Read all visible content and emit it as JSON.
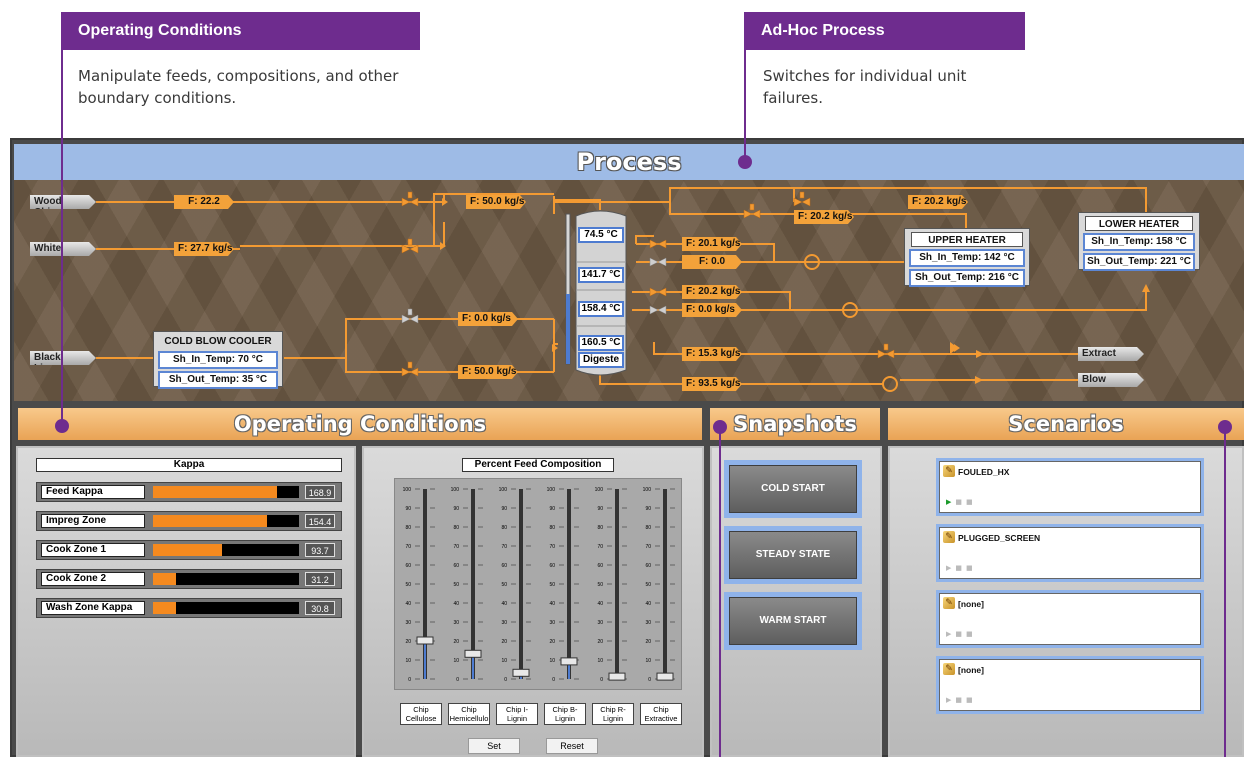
{
  "callouts": [
    {
      "title": "Operating Conditions",
      "text": "Manipulate feeds, compositions, and other boundary conditions."
    },
    {
      "title": "Ad-Hoc Process",
      "text": "Switches for individual unit failures."
    }
  ],
  "process": {
    "title": "Process",
    "streams": {
      "wood_chips": "Wood Chips",
      "white": "White",
      "black_liquor": "Black Liquor",
      "extract": "Extract",
      "blow": "Blow"
    },
    "flows": {
      "wood": "F: 22.2",
      "white": "F: 27.7 kg/s",
      "wood_to_digester": "F: 50.0 kg/s",
      "top_right": "F: 20.2 kg/s",
      "mid_top": "F: 20.2 kg/s",
      "upper_a": "F: 20.1 kg/s",
      "upper_b": "F: 0.0",
      "mid_a": "F: 20.2 kg/s",
      "mid_b": "F: 0.0 kg/s",
      "black_top": "F: 0.0 kg/s",
      "black_bot": "F: 50.0 kg/s",
      "extract": "F: 15.3 kg/s",
      "blow": "F: 93.5 kg/s"
    },
    "digester": {
      "t1": "74.5 °C",
      "t2": "141.7 °C",
      "t3": "158.4 °C",
      "t4": "160.5 °C",
      "label": "Digeste"
    },
    "cold_blow_cooler": {
      "title": "COLD BLOW COOLER",
      "in_temp": "Sh_In_Temp: 70 °C",
      "out_temp": "Sh_Out_Temp: 35 °C"
    },
    "upper_heater": {
      "title": "UPPER HEATER",
      "in_temp": "Sh_In_Temp: 142 °C",
      "out_temp": "Sh_Out_Temp: 216 °C"
    },
    "lower_heater": {
      "title": "LOWER HEATER",
      "in_temp": "Sh_In_Temp: 158 °C",
      "out_temp": "Sh_Out_Temp: 221 °C"
    }
  },
  "operating_conditions": {
    "title": "Operating Conditions",
    "kappa_title": "Kappa",
    "kappa": [
      {
        "label": "Feed Kappa",
        "value": "168.9",
        "fraction": 0.85
      },
      {
        "label": "Impreg Zone",
        "value": "154.4",
        "fraction": 0.78
      },
      {
        "label": "Cook Zone 1",
        "value": "93.7",
        "fraction": 0.47
      },
      {
        "label": "Cook Zone 2",
        "value": "31.2",
        "fraction": 0.16
      },
      {
        "label": "Wash Zone Kappa",
        "value": "30.8",
        "fraction": 0.16
      }
    ],
    "composition_title": "Percent Feed Composition",
    "scale_ticks": [
      "100",
      "90",
      "80",
      "70",
      "60",
      "50",
      "40",
      "30",
      "20",
      "10",
      "0"
    ],
    "components": [
      {
        "label": "Chip Cellulose",
        "value": 20
      },
      {
        "label": "Chip Hemicellulo",
        "value": 13
      },
      {
        "label": "Chip I-Lignin",
        "value": 3
      },
      {
        "label": "Chip B-Lignin",
        "value": 9
      },
      {
        "label": "Chip R-Lignin",
        "value": 1
      },
      {
        "label": "Chip Extractive",
        "value": 1
      }
    ],
    "set_label": "Set",
    "reset_label": "Reset"
  },
  "snapshots": {
    "title": "Snapshots",
    "buttons": [
      "COLD START",
      "STEADY STATE",
      "WARM START"
    ]
  },
  "scenarios": {
    "title": "Scenarios",
    "items": [
      {
        "name": "FOULED_HX",
        "active": true
      },
      {
        "name": "PLUGGED_SCREEN",
        "active": false
      },
      {
        "name": "[none]",
        "active": false
      },
      {
        "name": "[none]",
        "active": false
      }
    ]
  },
  "colors": {
    "callout": "#6e2c8e",
    "pipe": "#f39a32",
    "header_blue": "#9ebbe6",
    "header_orange": "#eea95a"
  }
}
